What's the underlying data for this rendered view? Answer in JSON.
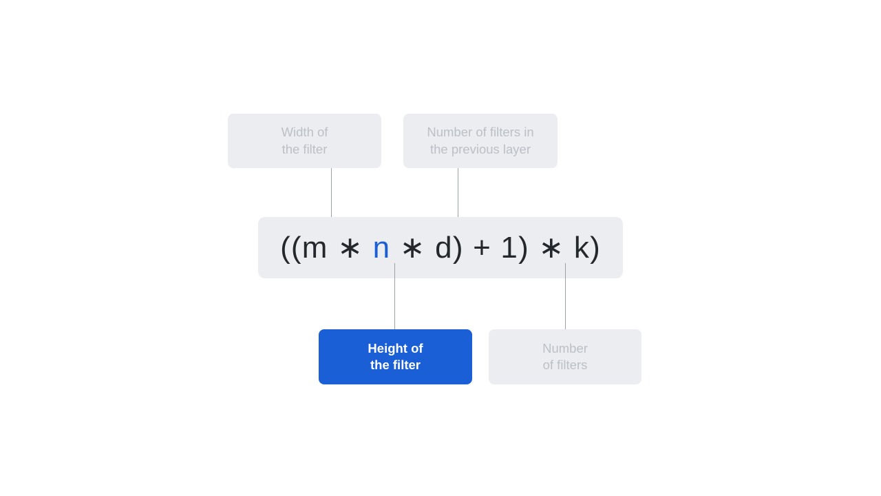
{
  "diagram": {
    "type": "annotated-formula",
    "title": "CNN parameter count formula with labeled terms",
    "background_color": "#ffffff",
    "colors": {
      "box_muted_bg": "#ebedf0",
      "box_muted_text": "#bcc0c6",
      "accent_bg": "#1a5fd6",
      "accent_text": "#ffffff",
      "formula_text": "#24272b",
      "highlight_text": "#1a5fd6",
      "connector_line": "#9aa0a6"
    },
    "formula": {
      "full_text": "((m ∗ n ∗ d) + 1) ∗ k)",
      "tokens": [
        {
          "text": "((m",
          "highlight": false
        },
        {
          "text": " ∗ ",
          "highlight": false
        },
        {
          "text": "n",
          "highlight": true
        },
        {
          "text": " ∗ ",
          "highlight": false
        },
        {
          "text": "d) + 1) ∗ k)",
          "highlight": false
        }
      ],
      "variables": {
        "m": "Width of the filter",
        "n": "Height of the filter",
        "d": "Number of filters in the previous layer",
        "k": "Number of filters"
      }
    },
    "callouts": {
      "width_of_filter": {
        "label": "Width of\nthe filter",
        "state": "inactive",
        "position": "top-left",
        "points_to": "m"
      },
      "number_of_filters_previous_layer": {
        "label": "Number of filters in\nthe previous layer",
        "state": "inactive",
        "position": "top-right",
        "points_to": "d"
      },
      "height_of_filter": {
        "label": "Height of\nthe filter",
        "state": "active",
        "position": "bottom-left",
        "points_to": "n"
      },
      "number_of_filters": {
        "label": "Number\nof filters",
        "state": "inactive",
        "position": "bottom-right",
        "points_to": "k"
      }
    }
  }
}
